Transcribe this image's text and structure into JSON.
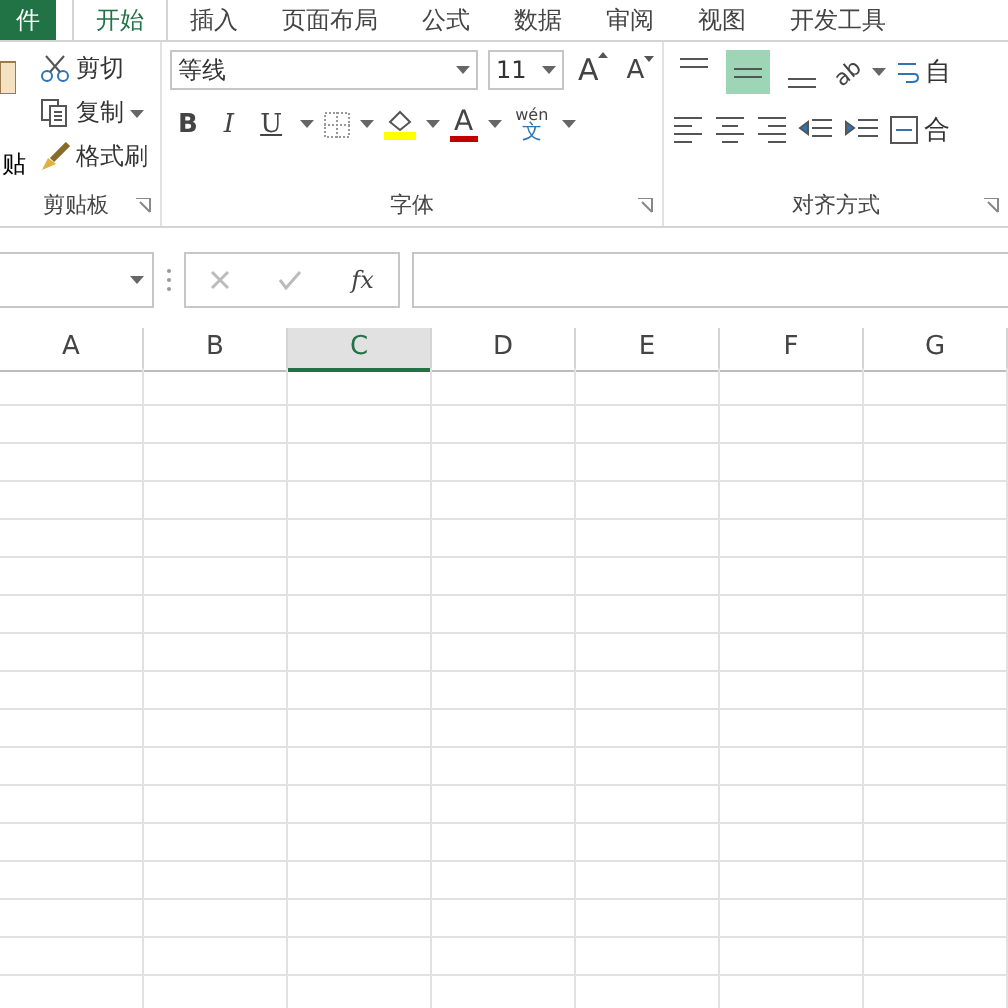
{
  "tabs": [
    {
      "label": "件",
      "selected": false,
      "kind": "file"
    },
    {
      "label": "开始",
      "selected": true,
      "kind": "tab"
    },
    {
      "label": "插入",
      "selected": false,
      "kind": "tab"
    },
    {
      "label": "页面布局",
      "selected": false,
      "kind": "tab"
    },
    {
      "label": "公式",
      "selected": false,
      "kind": "tab"
    },
    {
      "label": "数据",
      "selected": false,
      "kind": "tab"
    },
    {
      "label": "审阅",
      "selected": false,
      "kind": "tab"
    },
    {
      "label": "视图",
      "selected": false,
      "kind": "tab"
    },
    {
      "label": "开发工具",
      "selected": false,
      "kind": "tab"
    }
  ],
  "clipboard": {
    "paste_label": "贴",
    "items": [
      {
        "label": "剪切",
        "kind": "cut"
      },
      {
        "label": "复制",
        "kind": "copy"
      },
      {
        "label": "格式刷",
        "kind": "brush"
      }
    ],
    "group_label": "剪贴板"
  },
  "font": {
    "font_name": "等线",
    "font_size": "11",
    "grow": "A",
    "shrink": "A",
    "styles": [
      {
        "label": "B",
        "kind": "bold"
      },
      {
        "label": "I",
        "kind": "italic"
      },
      {
        "label": "U",
        "kind": "underline"
      }
    ],
    "font_color": "A",
    "phonetic_top": "wén",
    "phonetic_bottom": "文",
    "group_label": "字体"
  },
  "alignment": {
    "vertical": [
      {
        "kind": "top",
        "selected": false
      },
      {
        "kind": "middle",
        "selected": true
      },
      {
        "kind": "bottom",
        "selected": false
      }
    ],
    "orientation": "ab",
    "wrap_label": "自",
    "merge_label": "合",
    "group_label": "对齐方式"
  },
  "formula_bar": {
    "fx": "fx"
  },
  "columns": [
    {
      "label": "A",
      "selected": false
    },
    {
      "label": "B",
      "selected": false
    },
    {
      "label": "C",
      "selected": true
    },
    {
      "label": "D",
      "selected": false
    },
    {
      "label": "E",
      "selected": false
    },
    {
      "label": "F",
      "selected": false
    },
    {
      "label": "G",
      "selected": false
    }
  ]
}
